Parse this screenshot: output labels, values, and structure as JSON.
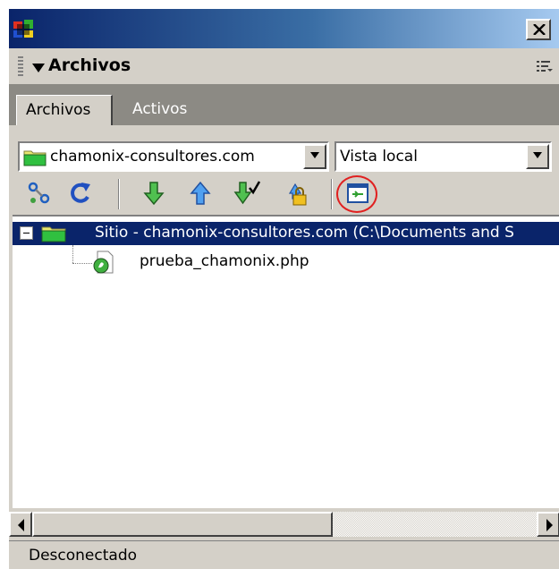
{
  "panel": {
    "title": "Archivos"
  },
  "tabs": [
    {
      "label": "Archivos",
      "active": true
    },
    {
      "label": "Activos",
      "active": false
    }
  ],
  "site_select": {
    "value": "chamonix-consultores.com"
  },
  "view_select": {
    "value": "Vista local"
  },
  "toolbar": {
    "icons": [
      "connect-icon",
      "refresh-icon",
      "get-files-icon",
      "put-files-icon",
      "check-out-icon",
      "check-in-icon",
      "expand-panel-icon"
    ]
  },
  "tree": {
    "root": {
      "label": "Sitio - chamonix-consultores.com (C:\\Documents and S",
      "expanded": true,
      "selected": true
    },
    "items": [
      {
        "label": "prueba_chamonix.php",
        "icon": "php-file-icon"
      }
    ]
  },
  "status": {
    "text": "Desconectado"
  },
  "colors": {
    "title_gradient_start": "#0a246a",
    "selection": "#0a246a",
    "face": "#d4d0c8",
    "highlight_ring": "#e02020"
  }
}
